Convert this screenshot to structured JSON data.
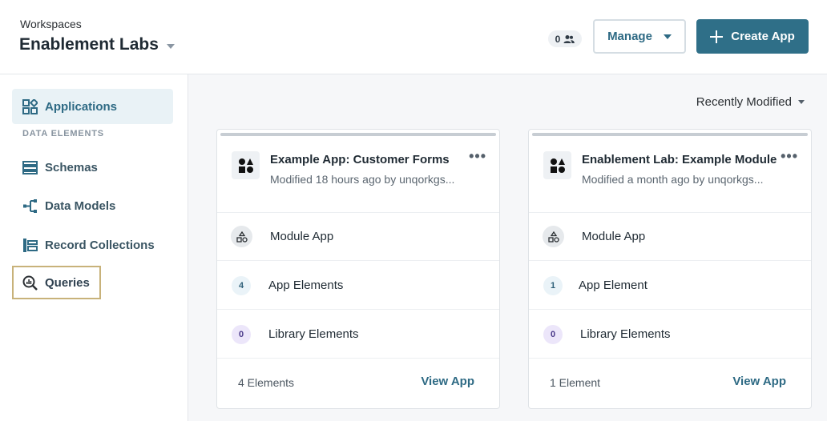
{
  "header": {
    "workspaces_label": "Workspaces",
    "workspace_name": "Enablement Labs",
    "member_count": "0",
    "manage_label": "Manage",
    "create_label": "Create App",
    "accent_color": "#2f6f88"
  },
  "sidebar": {
    "applications": "Applications",
    "section_label": "DATA ELEMENTS",
    "schemas": "Schemas",
    "data_models": "Data Models",
    "record_collections": "Record Collections",
    "queries": "Queries"
  },
  "main": {
    "sort_label": "Recently Modified",
    "cards": [
      {
        "title": "Example App: Customer Forms",
        "subtitle": "Modified 18 hours ago by unqorkgs...",
        "type": "Module App",
        "app_elements_count": "4",
        "app_elements_label": "App Elements",
        "library_count": "0",
        "library_label": "Library Elements",
        "footer_count": "4 Elements",
        "view_label": "View App"
      },
      {
        "title": "Enablement Lab: Example Module",
        "subtitle": "Modified a month ago by unqorkgs...",
        "type": "Module App",
        "app_elements_count": "1",
        "app_elements_label": "App Element",
        "library_count": "0",
        "library_label": "Library Elements",
        "footer_count": "1 Element",
        "view_label": "View App"
      }
    ]
  }
}
